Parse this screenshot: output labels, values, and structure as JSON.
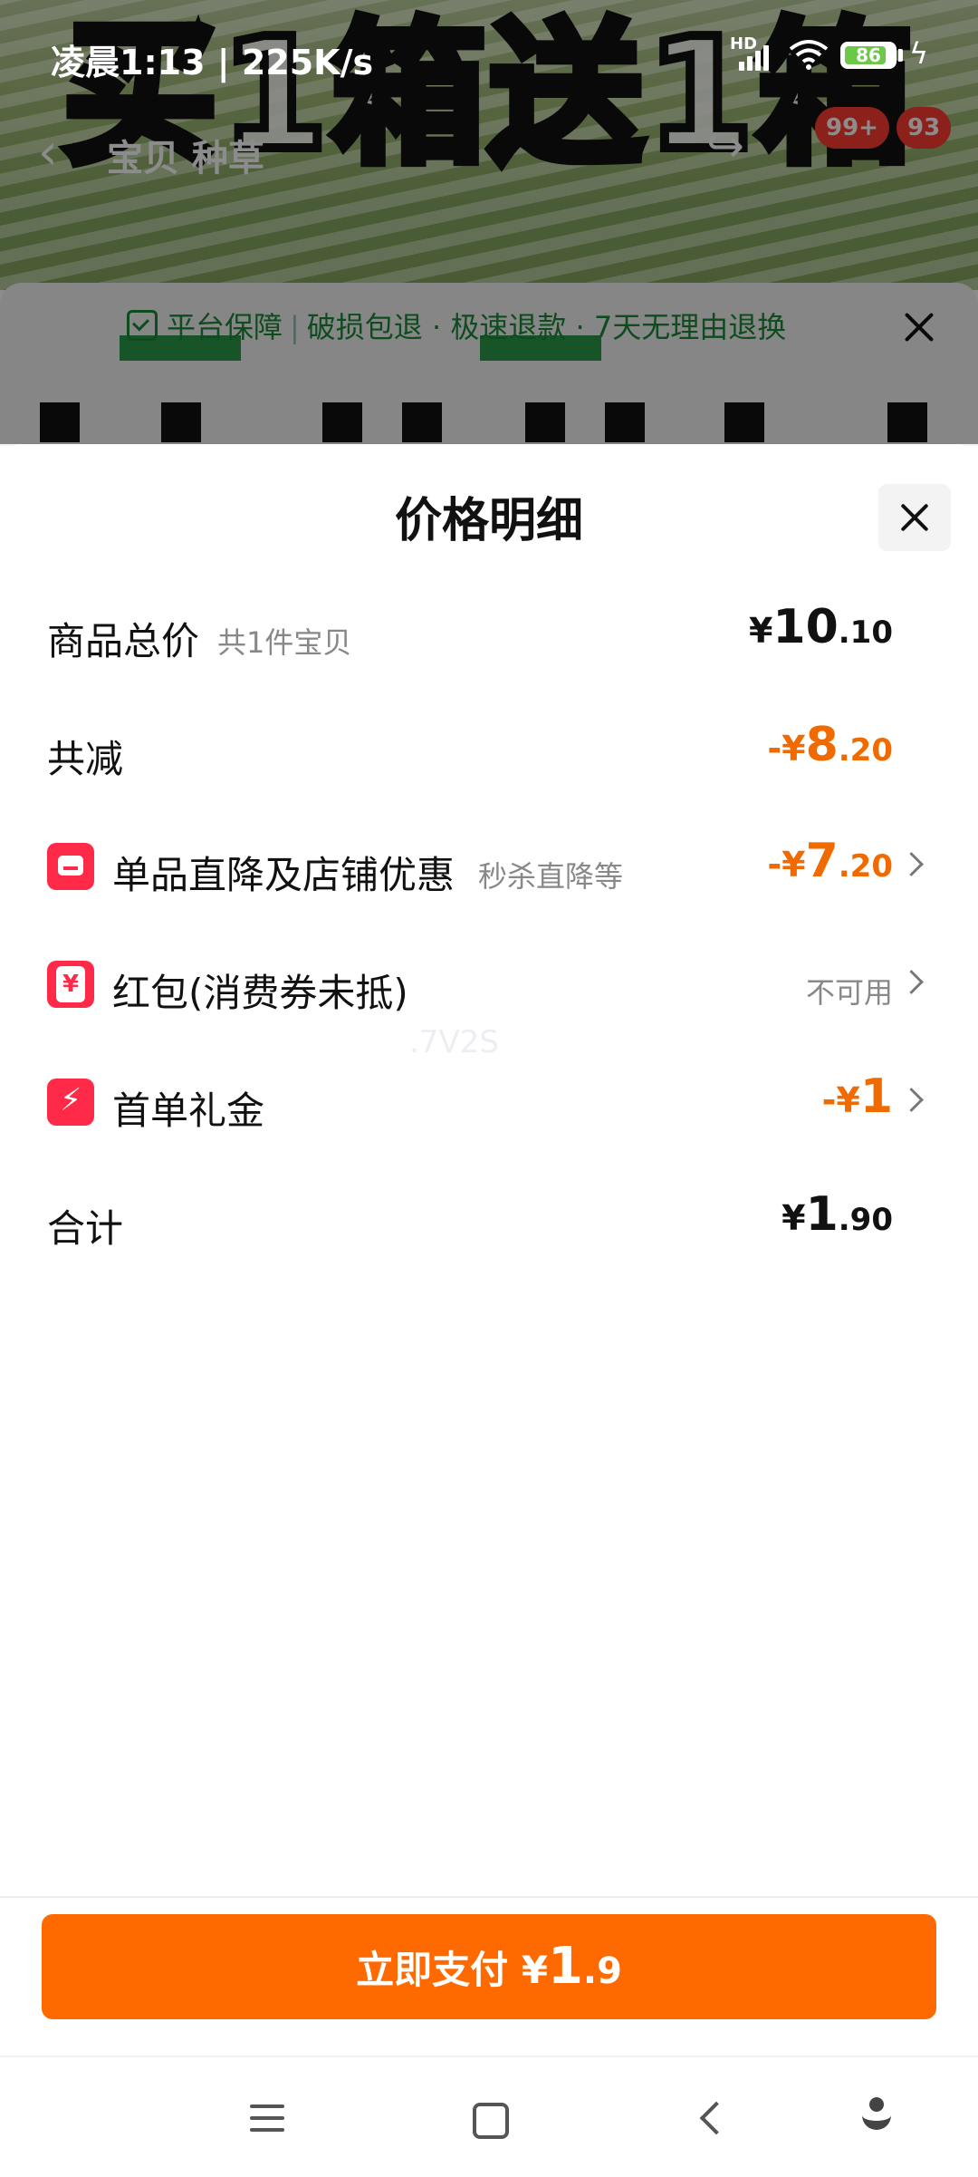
{
  "status_bar": {
    "time_speed": "凌晨1:13 | 225K/s",
    "network": "HD",
    "battery": "86",
    "battery_level": 0.86
  },
  "background_page": {
    "banner_text": "买1箱送1箱",
    "tabs": "宝贝 种草",
    "badge_messages": "99+",
    "badge_cart": "93",
    "guarantee": {
      "title": "平台保障",
      "items": "破损包退 · 极速退款 · 7天无理由退换"
    }
  },
  "sheet": {
    "title": "价格明细",
    "rows": [
      {
        "label": "商品总价",
        "sub": "共1件宝贝",
        "value_int": "10",
        "value_dec": ".10",
        "prefix": "¥"
      },
      {
        "label": "共减",
        "value_int": "8",
        "value_dec": ".20",
        "prefix": "-¥"
      },
      {
        "label": "单品直降及店铺优惠",
        "sub": "秒杀直降等",
        "value_int": "7",
        "value_dec": ".20",
        "prefix": "-¥",
        "icon": "shop-icon"
      },
      {
        "label": "红包(消费券未抵)",
        "status": "不可用",
        "icon": "red-packet-icon"
      },
      {
        "label": "首单礼金",
        "value_int": "1",
        "value_dec": "",
        "prefix": "-¥",
        "icon": "lightning-icon"
      },
      {
        "label": "合计",
        "value_int": "1",
        "value_dec": ".90",
        "prefix": "¥"
      }
    ],
    "watermark": ".7V2S"
  },
  "pay_button": {
    "label": "立即支付",
    "prefix": "¥",
    "int": "1",
    "dec": ".9"
  },
  "colors": {
    "accent_orange": "#ff6a00",
    "discount_orange": "#f06a00",
    "icon_red": "#ff2a48",
    "guarantee_green": "#1a8a3a"
  }
}
